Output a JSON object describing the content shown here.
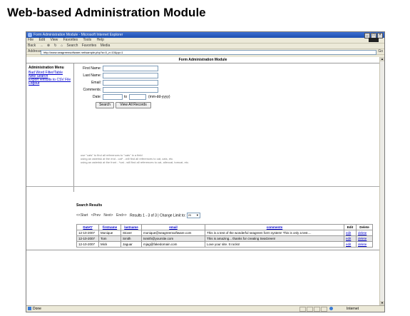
{
  "page_heading": "Web-based Administration Module",
  "window": {
    "title": "Form Administration Module - Microsoft Internet Explorer",
    "menu": [
      "File",
      "Edit",
      "View",
      "Favorites",
      "Tools",
      "Help"
    ],
    "toolbar": [
      "Back",
      "Search",
      "Favorites",
      "Media"
    ],
    "address_label": "Address",
    "address": "http://www.seagreensoftware.net/sample.php?a=0_z=10&pp=1",
    "go_label": "Go",
    "status": "Done",
    "zone": "Internet"
  },
  "app": {
    "title": "Form Administration Module",
    "sidebar": {
      "title": "Administration Menu",
      "links": [
        "Bad Word Filter/Table",
        "New Search",
        "Export Results to CSV File",
        "Logout"
      ]
    },
    "form": {
      "first_name": "First Name:",
      "last_name": "Last Name:",
      "email": "Email:",
      "comments": "Comments:",
      "date": "Date:",
      "to": "to",
      "date_format": "(mm-dd-yyyy)",
      "search_button": "Search",
      "view_all_button": "View All Records"
    },
    "hints": [
      "use \"cats\" to find all references to \"cats\" in a field",
      "using an asterisk at the end - cat* - will find all references to cat, cats, etc.",
      "using an asterisk at the front - *cat - will find all references to cat, allexcat, tomcat, etc."
    ],
    "results": {
      "title": "Search Results",
      "pager": {
        "start": "<<Start",
        "prev": "<Prev",
        "next": "Next>",
        "end": "End>>",
        "summary": "Results 1 - 3 of 3 | Change Limit to:",
        "limit": "20"
      },
      "columns": [
        "Date▽",
        "firstname",
        "lastname",
        "email",
        "comments",
        "Edit",
        "Delete"
      ],
      "rows": [
        {
          "date": "12-10-2007",
          "firstname": "Monique",
          "lastname": "Stover",
          "email": "monique@seagreensoftware.com",
          "comments": "This is a test of the wonderful seagreen form system! This is only a test....",
          "edit": "edit",
          "delete": "delete"
        },
        {
          "date": "12-10-2007",
          "firstname": "Tom",
          "lastname": "Smith",
          "email": "tsmith@yoursite.com",
          "comments": "This is amazing... thanks for creating SeaGreen!",
          "edit": "edit",
          "delete": "delete"
        },
        {
          "date": "12-10-2007",
          "firstname": "Mick",
          "lastname": "Jaguar",
          "email": "mjag@fakedomain.com",
          "comments": "Love your site. It rocks!",
          "edit": "edit",
          "delete": "delete"
        }
      ]
    }
  }
}
